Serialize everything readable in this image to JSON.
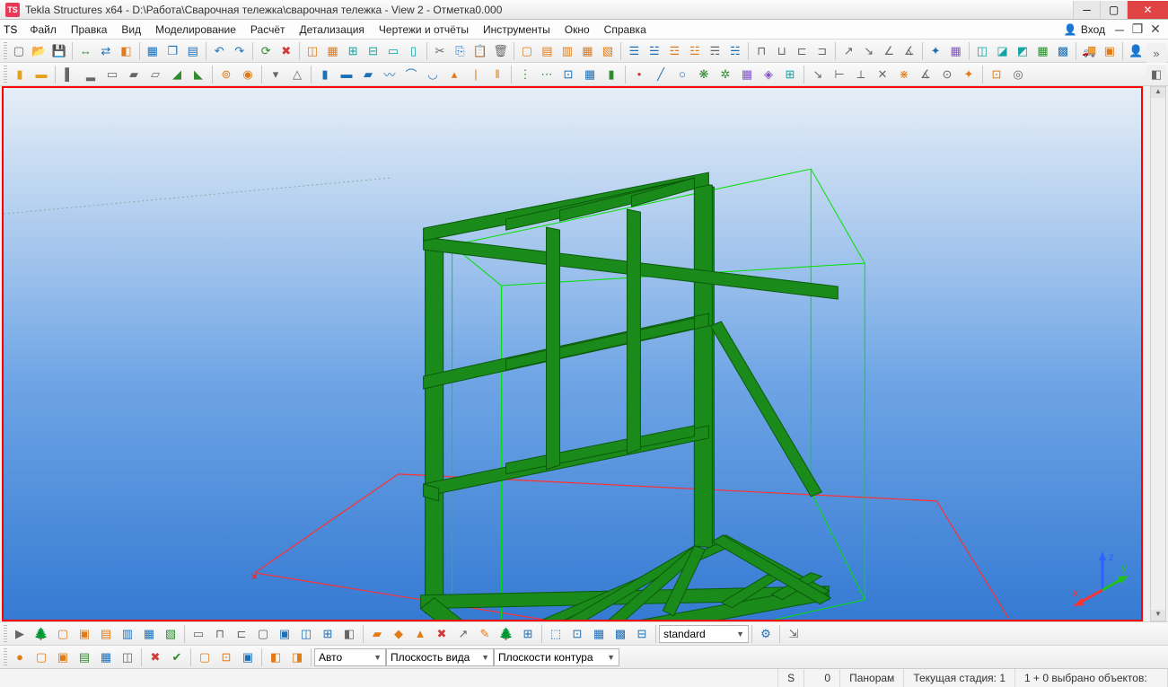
{
  "title": "Tekla Structures x64 - D:\\Работа\\Сварочная тележка\\сварочная тележка  - View 2 - Отметка0.000",
  "menu": {
    "items": [
      "Файл",
      "Правка",
      "Вид",
      "Моделирование",
      "Расчёт",
      "Детализация",
      "Чертежи и отчёты",
      "Инструменты",
      "Окно",
      "Справка"
    ],
    "login": "Вход"
  },
  "toolbars": {
    "row1": {
      "g1": [
        {
          "name": "new-icon",
          "glyph": "▢",
          "cls": "c-gray"
        },
        {
          "name": "open-icon",
          "glyph": "📂",
          "cls": "c-yellow"
        },
        {
          "name": "save-icon",
          "glyph": "💾",
          "cls": "c-blue"
        }
      ],
      "g2": [
        {
          "name": "share-icon",
          "glyph": "↔",
          "cls": "c-green"
        },
        {
          "name": "link-icon",
          "glyph": "⇄",
          "cls": "c-blue"
        },
        {
          "name": "publish-icon",
          "glyph": "◧",
          "cls": "c-orange"
        }
      ],
      "g3": [
        {
          "name": "cube-icon",
          "glyph": "▦",
          "cls": "c-blue"
        },
        {
          "name": "layers-icon",
          "glyph": "❐",
          "cls": "c-blue"
        },
        {
          "name": "list-icon",
          "glyph": "▤",
          "cls": "c-blue"
        }
      ],
      "g4": [
        {
          "name": "undo-icon",
          "glyph": "↶",
          "cls": "c-blue"
        },
        {
          "name": "redo-icon",
          "glyph": "↷",
          "cls": "c-blue"
        }
      ],
      "g5": [
        {
          "name": "repeat-icon",
          "glyph": "⟳",
          "cls": "c-green"
        },
        {
          "name": "stop-icon",
          "glyph": "✖",
          "cls": "c-red"
        }
      ],
      "g6": [
        {
          "name": "model-icon",
          "glyph": "◫",
          "cls": "c-orange"
        },
        {
          "name": "grid1-icon",
          "glyph": "▦",
          "cls": "c-orange"
        },
        {
          "name": "grid2-icon",
          "glyph": "⊞",
          "cls": "c-cyan"
        },
        {
          "name": "grid3-icon",
          "glyph": "⊟",
          "cls": "c-cyan"
        },
        {
          "name": "slab-icon",
          "glyph": "▭",
          "cls": "c-cyan"
        },
        {
          "name": "wall-icon",
          "glyph": "▯",
          "cls": "c-cyan"
        }
      ],
      "g7": [
        {
          "name": "cut-icon",
          "glyph": "✂",
          "cls": "c-gray"
        },
        {
          "name": "copy-icon",
          "glyph": "⎘",
          "cls": "c-blue"
        },
        {
          "name": "paste-icon",
          "glyph": "📋",
          "cls": "c-orange"
        },
        {
          "name": "delete-icon",
          "glyph": "🗑",
          "cls": "c-gray"
        }
      ],
      "g8": [
        {
          "name": "drawing1-icon",
          "glyph": "▢",
          "cls": "c-orange"
        },
        {
          "name": "drawing2-icon",
          "glyph": "▤",
          "cls": "c-orange"
        },
        {
          "name": "drawing3-icon",
          "glyph": "▥",
          "cls": "c-orange"
        },
        {
          "name": "drawing4-icon",
          "glyph": "▦",
          "cls": "c-orange"
        },
        {
          "name": "drawing5-icon",
          "glyph": "▧",
          "cls": "c-orange"
        }
      ],
      "g9": [
        {
          "name": "report1-icon",
          "glyph": "☰",
          "cls": "c-blue"
        },
        {
          "name": "report2-icon",
          "glyph": "☱",
          "cls": "c-blue"
        },
        {
          "name": "report3-icon",
          "glyph": "☲",
          "cls": "c-orange"
        },
        {
          "name": "report4-icon",
          "glyph": "☳",
          "cls": "c-orange"
        },
        {
          "name": "report5-icon",
          "glyph": "☴",
          "cls": "c-gray"
        },
        {
          "name": "report6-icon",
          "glyph": "☵",
          "cls": "c-blue"
        }
      ],
      "g10": [
        {
          "name": "frame1-icon",
          "glyph": "⊓",
          "cls": "c-gray"
        },
        {
          "name": "frame2-icon",
          "glyph": "⊔",
          "cls": "c-gray"
        },
        {
          "name": "frame3-icon",
          "glyph": "⊏",
          "cls": "c-gray"
        },
        {
          "name": "frame4-icon",
          "glyph": "⊐",
          "cls": "c-gray"
        }
      ],
      "g11": [
        {
          "name": "measure1-icon",
          "glyph": "↗",
          "cls": "c-gray"
        },
        {
          "name": "measure2-icon",
          "glyph": "↘",
          "cls": "c-gray"
        },
        {
          "name": "measure3-icon",
          "glyph": "∠",
          "cls": "c-gray"
        },
        {
          "name": "measure4-icon",
          "glyph": "∡",
          "cls": "c-gray"
        }
      ],
      "g12": [
        {
          "name": "compass-icon",
          "glyph": "✦",
          "cls": "c-blue"
        },
        {
          "name": "grid-icon",
          "glyph": "▦",
          "cls": "c-purple"
        }
      ],
      "g13": [
        {
          "name": "phase1-icon",
          "glyph": "◫",
          "cls": "c-cyan"
        },
        {
          "name": "phase2-icon",
          "glyph": "◪",
          "cls": "c-cyan"
        },
        {
          "name": "phase3-icon",
          "glyph": "◩",
          "cls": "c-cyan"
        },
        {
          "name": "phase4-icon",
          "glyph": "▦",
          "cls": "c-green"
        },
        {
          "name": "phase5-icon",
          "glyph": "▩",
          "cls": "c-blue"
        }
      ],
      "g14": [
        {
          "name": "truck-icon",
          "glyph": "🚚",
          "cls": "c-red"
        },
        {
          "name": "nc-icon",
          "glyph": "▣",
          "cls": "c-orange"
        }
      ],
      "g15": [
        {
          "name": "user1-icon",
          "glyph": "👤",
          "cls": "c-orange"
        },
        {
          "name": "user2-icon",
          "glyph": "👥",
          "cls": "c-orange"
        }
      ]
    },
    "row2": {
      "g1": [
        {
          "name": "column-icon",
          "glyph": "▮",
          "cls": "c-yellow"
        },
        {
          "name": "beam-icon",
          "glyph": "▬",
          "cls": "c-yellow"
        }
      ],
      "g2": [
        {
          "name": "plate1-icon",
          "glyph": "▌",
          "cls": "c-gray"
        },
        {
          "name": "plate2-icon",
          "glyph": "▂",
          "cls": "c-gray"
        },
        {
          "name": "plate3-icon",
          "glyph": "▭",
          "cls": "c-gray"
        },
        {
          "name": "plate4-icon",
          "glyph": "▰",
          "cls": "c-gray"
        },
        {
          "name": "plate5-icon",
          "glyph": "▱",
          "cls": "c-gray"
        },
        {
          "name": "plate6-icon",
          "glyph": "◢",
          "cls": "c-green"
        },
        {
          "name": "plate7-icon",
          "glyph": "◣",
          "cls": "c-green"
        }
      ],
      "g3": [
        {
          "name": "bolt1-icon",
          "glyph": "⊚",
          "cls": "c-orange"
        },
        {
          "name": "bolt2-icon",
          "glyph": "◉",
          "cls": "c-orange"
        }
      ],
      "g4": [
        {
          "name": "weld1-icon",
          "glyph": "▾",
          "cls": "c-gray"
        },
        {
          "name": "weld2-icon",
          "glyph": "△",
          "cls": "c-gray"
        }
      ],
      "g5": [
        {
          "name": "profile1-icon",
          "glyph": "▮",
          "cls": "c-blue"
        },
        {
          "name": "profile2-icon",
          "glyph": "▬",
          "cls": "c-blue"
        },
        {
          "name": "profile3-icon",
          "glyph": "▰",
          "cls": "c-blue"
        },
        {
          "name": "profile4-icon",
          "glyph": "〰",
          "cls": "c-blue"
        },
        {
          "name": "profile5-icon",
          "glyph": "⌒",
          "cls": "c-blue"
        },
        {
          "name": "profile6-icon",
          "glyph": "◡",
          "cls": "c-blue"
        },
        {
          "name": "profile7-icon",
          "glyph": "▴",
          "cls": "c-orange"
        },
        {
          "name": "profile8-icon",
          "glyph": "|",
          "cls": "c-orange"
        },
        {
          "name": "profile9-icon",
          "glyph": "‖",
          "cls": "c-orange"
        }
      ],
      "g6": [
        {
          "name": "rebar1-icon",
          "glyph": "⋮",
          "cls": "c-green"
        },
        {
          "name": "rebar2-icon",
          "glyph": "⋯",
          "cls": "c-green"
        },
        {
          "name": "rebar3-icon",
          "glyph": "⊡",
          "cls": "c-blue"
        },
        {
          "name": "rebar4-icon",
          "glyph": "▦",
          "cls": "c-blue"
        },
        {
          "name": "rebar5-icon",
          "glyph": "▮",
          "cls": "c-green"
        }
      ],
      "g7": [
        {
          "name": "point-icon",
          "glyph": "•",
          "cls": "c-red"
        },
        {
          "name": "line-icon",
          "glyph": "╱",
          "cls": "c-blue"
        },
        {
          "name": "circle-icon",
          "glyph": "○",
          "cls": "c-blue"
        },
        {
          "name": "comp1-icon",
          "glyph": "❋",
          "cls": "c-green"
        },
        {
          "name": "comp2-icon",
          "glyph": "✲",
          "cls": "c-green"
        },
        {
          "name": "comp3-icon",
          "glyph": "▦",
          "cls": "c-purple"
        },
        {
          "name": "comp4-icon",
          "glyph": "◈",
          "cls": "c-purple"
        },
        {
          "name": "comp5-icon",
          "glyph": "⊞",
          "cls": "c-cyan"
        }
      ],
      "g8": [
        {
          "name": "snap1-icon",
          "glyph": "↘",
          "cls": "c-gray"
        },
        {
          "name": "snap2-icon",
          "glyph": "⊢",
          "cls": "c-gray"
        },
        {
          "name": "snap3-icon",
          "glyph": "⟂",
          "cls": "c-gray"
        },
        {
          "name": "snap4-icon",
          "glyph": "✕",
          "cls": "c-gray"
        },
        {
          "name": "snap5-icon",
          "glyph": "⋇",
          "cls": "c-orange"
        },
        {
          "name": "snap6-icon",
          "glyph": "∡",
          "cls": "c-gray"
        },
        {
          "name": "snap7-icon",
          "glyph": "⊙",
          "cls": "c-gray"
        },
        {
          "name": "snap8-icon",
          "glyph": "✦",
          "cls": "c-orange"
        }
      ],
      "g9": [
        {
          "name": "view1-icon",
          "glyph": "⊡",
          "cls": "c-orange"
        },
        {
          "name": "view2-icon",
          "glyph": "◎",
          "cls": "c-gray"
        }
      ]
    }
  },
  "side": [
    {
      "name": "expand-icon",
      "glyph": "»",
      "cls": "c-gray"
    },
    {
      "name": "render-icon",
      "glyph": "◧",
      "cls": "c-gray"
    },
    {
      "name": "apps-icon",
      "glyph": "⠿",
      "cls": "c-gray"
    }
  ],
  "bottom1": {
    "g1": [
      {
        "name": "sel-arrow-icon",
        "glyph": "▶",
        "cls": "c-gray"
      },
      {
        "name": "sel-tree-icon",
        "glyph": "🌲",
        "cls": "c-green"
      },
      {
        "name": "sel-box1-icon",
        "glyph": "▢",
        "cls": "c-orange"
      },
      {
        "name": "sel-box2-icon",
        "glyph": "▣",
        "cls": "c-orange"
      },
      {
        "name": "sel-box3-icon",
        "glyph": "▤",
        "cls": "c-orange"
      },
      {
        "name": "sel-box4-icon",
        "glyph": "▥",
        "cls": "c-blue"
      },
      {
        "name": "sel-box5-icon",
        "glyph": "▦",
        "cls": "c-blue"
      },
      {
        "name": "sel-box6-icon",
        "glyph": "▧",
        "cls": "c-green"
      }
    ],
    "g2": [
      {
        "name": "filter1-icon",
        "glyph": "▭",
        "cls": "c-gray"
      },
      {
        "name": "filter2-icon",
        "glyph": "⊓",
        "cls": "c-gray"
      },
      {
        "name": "filter3-icon",
        "glyph": "⊏",
        "cls": "c-gray"
      },
      {
        "name": "filter4-icon",
        "glyph": "▢",
        "cls": "c-gray"
      },
      {
        "name": "filter5-icon",
        "glyph": "▣",
        "cls": "c-blue"
      },
      {
        "name": "filter6-icon",
        "glyph": "◫",
        "cls": "c-blue"
      },
      {
        "name": "filter7-icon",
        "glyph": "⊞",
        "cls": "c-blue"
      },
      {
        "name": "filter8-icon",
        "glyph": "◧",
        "cls": "c-gray"
      }
    ],
    "g3": [
      {
        "name": "obj1-icon",
        "glyph": "▰",
        "cls": "c-orange"
      },
      {
        "name": "obj2-icon",
        "glyph": "◆",
        "cls": "c-orange"
      },
      {
        "name": "obj3-icon",
        "glyph": "▲",
        "cls": "c-orange"
      },
      {
        "name": "obj4-icon",
        "glyph": "✖",
        "cls": "c-red"
      },
      {
        "name": "obj5-icon",
        "glyph": "↗",
        "cls": "c-gray"
      },
      {
        "name": "obj6-icon",
        "glyph": "✎",
        "cls": "c-orange"
      },
      {
        "name": "obj7-icon",
        "glyph": "🌲",
        "cls": "c-green"
      },
      {
        "name": "obj8-icon",
        "glyph": "⊞",
        "cls": "c-blue"
      }
    ],
    "g4": [
      {
        "name": "area1-icon",
        "glyph": "⬚",
        "cls": "c-blue"
      },
      {
        "name": "area2-icon",
        "glyph": "⊡",
        "cls": "c-blue"
      },
      {
        "name": "area3-icon",
        "glyph": "▦",
        "cls": "c-blue"
      },
      {
        "name": "area4-icon",
        "glyph": "▩",
        "cls": "c-blue"
      },
      {
        "name": "area5-icon",
        "glyph": "⊟",
        "cls": "c-blue"
      }
    ],
    "combo_value": "standard",
    "g5": [
      {
        "name": "adjust-icon",
        "glyph": "⚙",
        "cls": "c-blue"
      }
    ],
    "g6": [
      {
        "name": "lock-icon",
        "glyph": "⇲",
        "cls": "c-gray"
      }
    ]
  },
  "bottom2": {
    "g1": [
      {
        "name": "m1-icon",
        "glyph": "●",
        "cls": "c-orange"
      },
      {
        "name": "m2-icon",
        "glyph": "▢",
        "cls": "c-orange"
      },
      {
        "name": "m3-icon",
        "glyph": "▣",
        "cls": "c-orange"
      },
      {
        "name": "m4-icon",
        "glyph": "▤",
        "cls": "c-green"
      },
      {
        "name": "m5-icon",
        "glyph": "▦",
        "cls": "c-blue"
      },
      {
        "name": "m6-icon",
        "glyph": "◫",
        "cls": "c-gray"
      }
    ],
    "g2": [
      {
        "name": "m7-icon",
        "glyph": "✖",
        "cls": "c-red"
      },
      {
        "name": "m8-icon",
        "glyph": "✔",
        "cls": "c-green"
      }
    ],
    "g3": [
      {
        "name": "m9-icon",
        "glyph": "▢",
        "cls": "c-orange"
      },
      {
        "name": "m10-icon",
        "glyph": "⊡",
        "cls": "c-orange"
      },
      {
        "name": "m11-icon",
        "glyph": "▣",
        "cls": "c-blue"
      }
    ],
    "g4": [
      {
        "name": "m12-icon",
        "glyph": "◧",
        "cls": "c-orange"
      },
      {
        "name": "m13-icon",
        "glyph": "◨",
        "cls": "c-orange"
      }
    ],
    "combo1": "Авто",
    "combo2": "Плоскость вида",
    "combo3": "Плоскости контура"
  },
  "status": {
    "s_label": "S",
    "s_value": "0",
    "mode": "Панорам",
    "stage": "Текущая стадия: 1",
    "selection": "1 + 0 выбрано объектов:"
  },
  "viewport": {
    "origin_label": "x"
  }
}
